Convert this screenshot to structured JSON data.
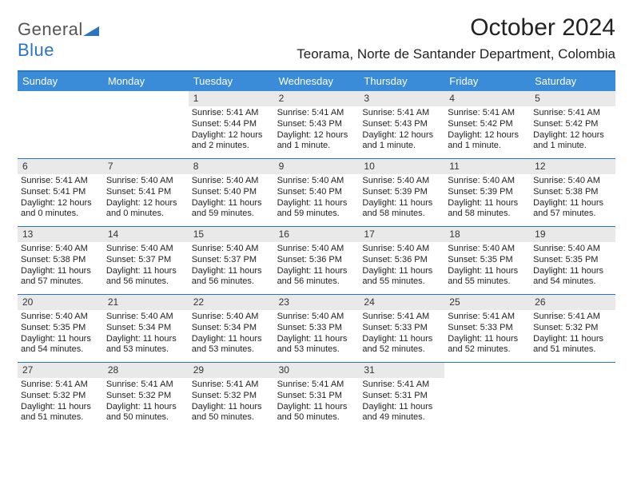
{
  "brand": {
    "name_a": "General",
    "name_b": "Blue"
  },
  "title": {
    "month": "October 2024",
    "location": "Teorama, Norte de Santander Department, Colombia"
  },
  "dayNames": [
    "Sunday",
    "Monday",
    "Tuesday",
    "Wednesday",
    "Thursday",
    "Friday",
    "Saturday"
  ],
  "startOffset": 2,
  "days": [
    {
      "n": 1,
      "sunrise": "5:41 AM",
      "sunset": "5:44 PM",
      "daylight": "12 hours and 2 minutes."
    },
    {
      "n": 2,
      "sunrise": "5:41 AM",
      "sunset": "5:43 PM",
      "daylight": "12 hours and 1 minute."
    },
    {
      "n": 3,
      "sunrise": "5:41 AM",
      "sunset": "5:43 PM",
      "daylight": "12 hours and 1 minute."
    },
    {
      "n": 4,
      "sunrise": "5:41 AM",
      "sunset": "5:42 PM",
      "daylight": "12 hours and 1 minute."
    },
    {
      "n": 5,
      "sunrise": "5:41 AM",
      "sunset": "5:42 PM",
      "daylight": "12 hours and 1 minute."
    },
    {
      "n": 6,
      "sunrise": "5:41 AM",
      "sunset": "5:41 PM",
      "daylight": "12 hours and 0 minutes."
    },
    {
      "n": 7,
      "sunrise": "5:40 AM",
      "sunset": "5:41 PM",
      "daylight": "12 hours and 0 minutes."
    },
    {
      "n": 8,
      "sunrise": "5:40 AM",
      "sunset": "5:40 PM",
      "daylight": "11 hours and 59 minutes."
    },
    {
      "n": 9,
      "sunrise": "5:40 AM",
      "sunset": "5:40 PM",
      "daylight": "11 hours and 59 minutes."
    },
    {
      "n": 10,
      "sunrise": "5:40 AM",
      "sunset": "5:39 PM",
      "daylight": "11 hours and 58 minutes."
    },
    {
      "n": 11,
      "sunrise": "5:40 AM",
      "sunset": "5:39 PM",
      "daylight": "11 hours and 58 minutes."
    },
    {
      "n": 12,
      "sunrise": "5:40 AM",
      "sunset": "5:38 PM",
      "daylight": "11 hours and 57 minutes."
    },
    {
      "n": 13,
      "sunrise": "5:40 AM",
      "sunset": "5:38 PM",
      "daylight": "11 hours and 57 minutes."
    },
    {
      "n": 14,
      "sunrise": "5:40 AM",
      "sunset": "5:37 PM",
      "daylight": "11 hours and 56 minutes."
    },
    {
      "n": 15,
      "sunrise": "5:40 AM",
      "sunset": "5:37 PM",
      "daylight": "11 hours and 56 minutes."
    },
    {
      "n": 16,
      "sunrise": "5:40 AM",
      "sunset": "5:36 PM",
      "daylight": "11 hours and 56 minutes."
    },
    {
      "n": 17,
      "sunrise": "5:40 AM",
      "sunset": "5:36 PM",
      "daylight": "11 hours and 55 minutes."
    },
    {
      "n": 18,
      "sunrise": "5:40 AM",
      "sunset": "5:35 PM",
      "daylight": "11 hours and 55 minutes."
    },
    {
      "n": 19,
      "sunrise": "5:40 AM",
      "sunset": "5:35 PM",
      "daylight": "11 hours and 54 minutes."
    },
    {
      "n": 20,
      "sunrise": "5:40 AM",
      "sunset": "5:35 PM",
      "daylight": "11 hours and 54 minutes."
    },
    {
      "n": 21,
      "sunrise": "5:40 AM",
      "sunset": "5:34 PM",
      "daylight": "11 hours and 53 minutes."
    },
    {
      "n": 22,
      "sunrise": "5:40 AM",
      "sunset": "5:34 PM",
      "daylight": "11 hours and 53 minutes."
    },
    {
      "n": 23,
      "sunrise": "5:40 AM",
      "sunset": "5:33 PM",
      "daylight": "11 hours and 53 minutes."
    },
    {
      "n": 24,
      "sunrise": "5:41 AM",
      "sunset": "5:33 PM",
      "daylight": "11 hours and 52 minutes."
    },
    {
      "n": 25,
      "sunrise": "5:41 AM",
      "sunset": "5:33 PM",
      "daylight": "11 hours and 52 minutes."
    },
    {
      "n": 26,
      "sunrise": "5:41 AM",
      "sunset": "5:32 PM",
      "daylight": "11 hours and 51 minutes."
    },
    {
      "n": 27,
      "sunrise": "5:41 AM",
      "sunset": "5:32 PM",
      "daylight": "11 hours and 51 minutes."
    },
    {
      "n": 28,
      "sunrise": "5:41 AM",
      "sunset": "5:32 PM",
      "daylight": "11 hours and 50 minutes."
    },
    {
      "n": 29,
      "sunrise": "5:41 AM",
      "sunset": "5:32 PM",
      "daylight": "11 hours and 50 minutes."
    },
    {
      "n": 30,
      "sunrise": "5:41 AM",
      "sunset": "5:31 PM",
      "daylight": "11 hours and 50 minutes."
    },
    {
      "n": 31,
      "sunrise": "5:41 AM",
      "sunset": "5:31 PM",
      "daylight": "11 hours and 49 minutes."
    }
  ],
  "labels": {
    "sunrise": "Sunrise:",
    "sunset": "Sunset:",
    "daylight": "Daylight:"
  }
}
